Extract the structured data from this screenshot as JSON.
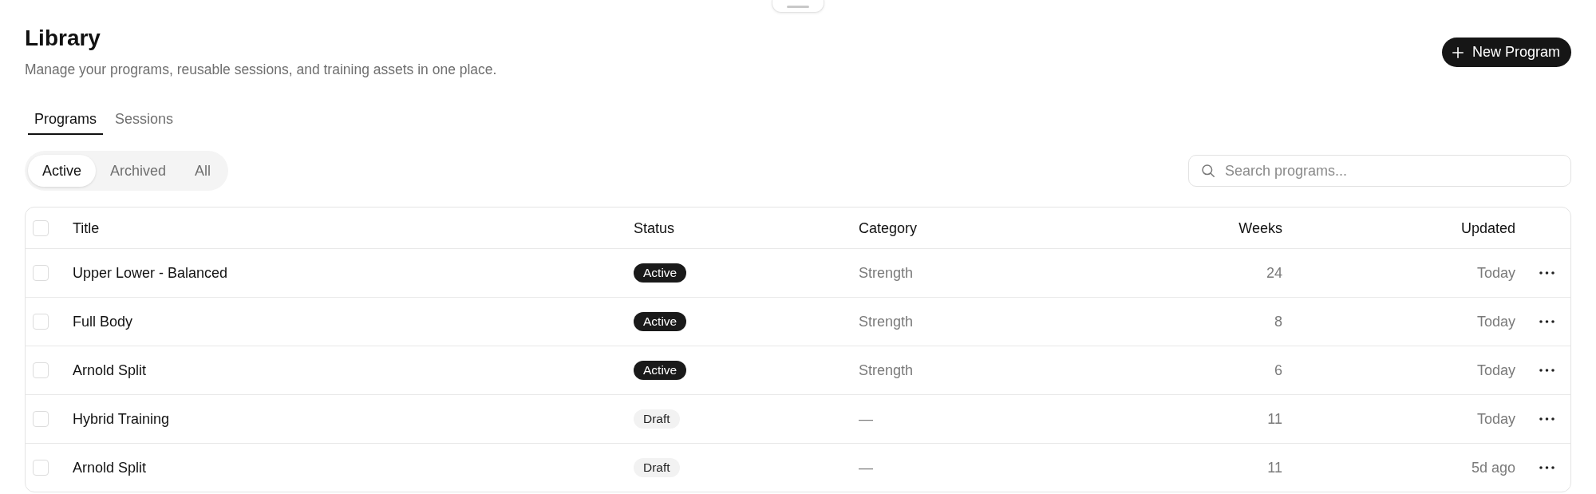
{
  "header": {
    "title": "Library",
    "subtitle": "Manage your programs, reusable sessions, and training assets in one place.",
    "action": {
      "label": "New Program"
    }
  },
  "tabs": [
    {
      "label": "Programs",
      "selected": true
    },
    {
      "label": "Sessions",
      "selected": false
    }
  ],
  "filters": [
    {
      "label": "Active",
      "selected": true
    },
    {
      "label": "Archived",
      "selected": false
    },
    {
      "label": "All",
      "selected": false
    }
  ],
  "search": {
    "placeholder": "Search programs..."
  },
  "table": {
    "select_all": {
      "checked": false
    },
    "columns": [
      "Title",
      "Status",
      "Category",
      "Weeks",
      "Updated"
    ],
    "rows": [
      {
        "checked": false,
        "title": "Upper Lower - Balanced",
        "status": {
          "label": "Active",
          "kind": "active"
        },
        "category": "Strength",
        "weeks": "24",
        "updated": "Today"
      },
      {
        "checked": false,
        "title": "Full Body",
        "status": {
          "label": "Active",
          "kind": "active"
        },
        "category": "Strength",
        "weeks": "8",
        "updated": "Today"
      },
      {
        "checked": false,
        "title": "Arnold Split",
        "status": {
          "label": "Active",
          "kind": "active"
        },
        "category": "Strength",
        "weeks": "6",
        "updated": "Today"
      },
      {
        "checked": false,
        "title": "Hybrid Training",
        "status": {
          "label": "Draft",
          "kind": "draft"
        },
        "category": "—",
        "weeks": "11",
        "updated": "Today"
      },
      {
        "checked": false,
        "title": "Arnold Split",
        "status": {
          "label": "Draft",
          "kind": "draft"
        },
        "category": "—",
        "weeks": "11",
        "updated": "5d ago"
      }
    ]
  }
}
